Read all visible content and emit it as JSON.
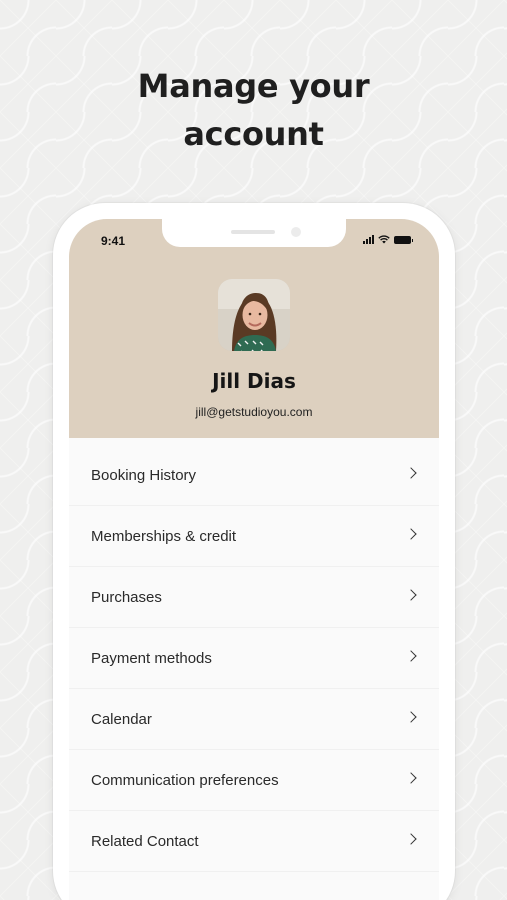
{
  "headline": {
    "line1": "Manage your",
    "line2": "account"
  },
  "status_bar": {
    "time": "9:41",
    "icons": [
      "signal-icon",
      "wifi-icon",
      "battery-icon"
    ]
  },
  "profile": {
    "avatar": "profile-photo",
    "name": "Jill Dias",
    "email": "jill@getstudioyou.com"
  },
  "menu": {
    "items": [
      {
        "label": "Booking History"
      },
      {
        "label": "Memberships & credit"
      },
      {
        "label": "Purchases"
      },
      {
        "label": "Payment methods"
      },
      {
        "label": "Calendar"
      },
      {
        "label": "Communication preferences"
      },
      {
        "label": "Related Contact"
      }
    ],
    "chevron_icon": "chevron-right-icon"
  },
  "colors": {
    "background": "#efefee",
    "header_beige": "#ddd0bf",
    "list_background": "#fafafa",
    "text_dark": "#1f1f1f"
  }
}
